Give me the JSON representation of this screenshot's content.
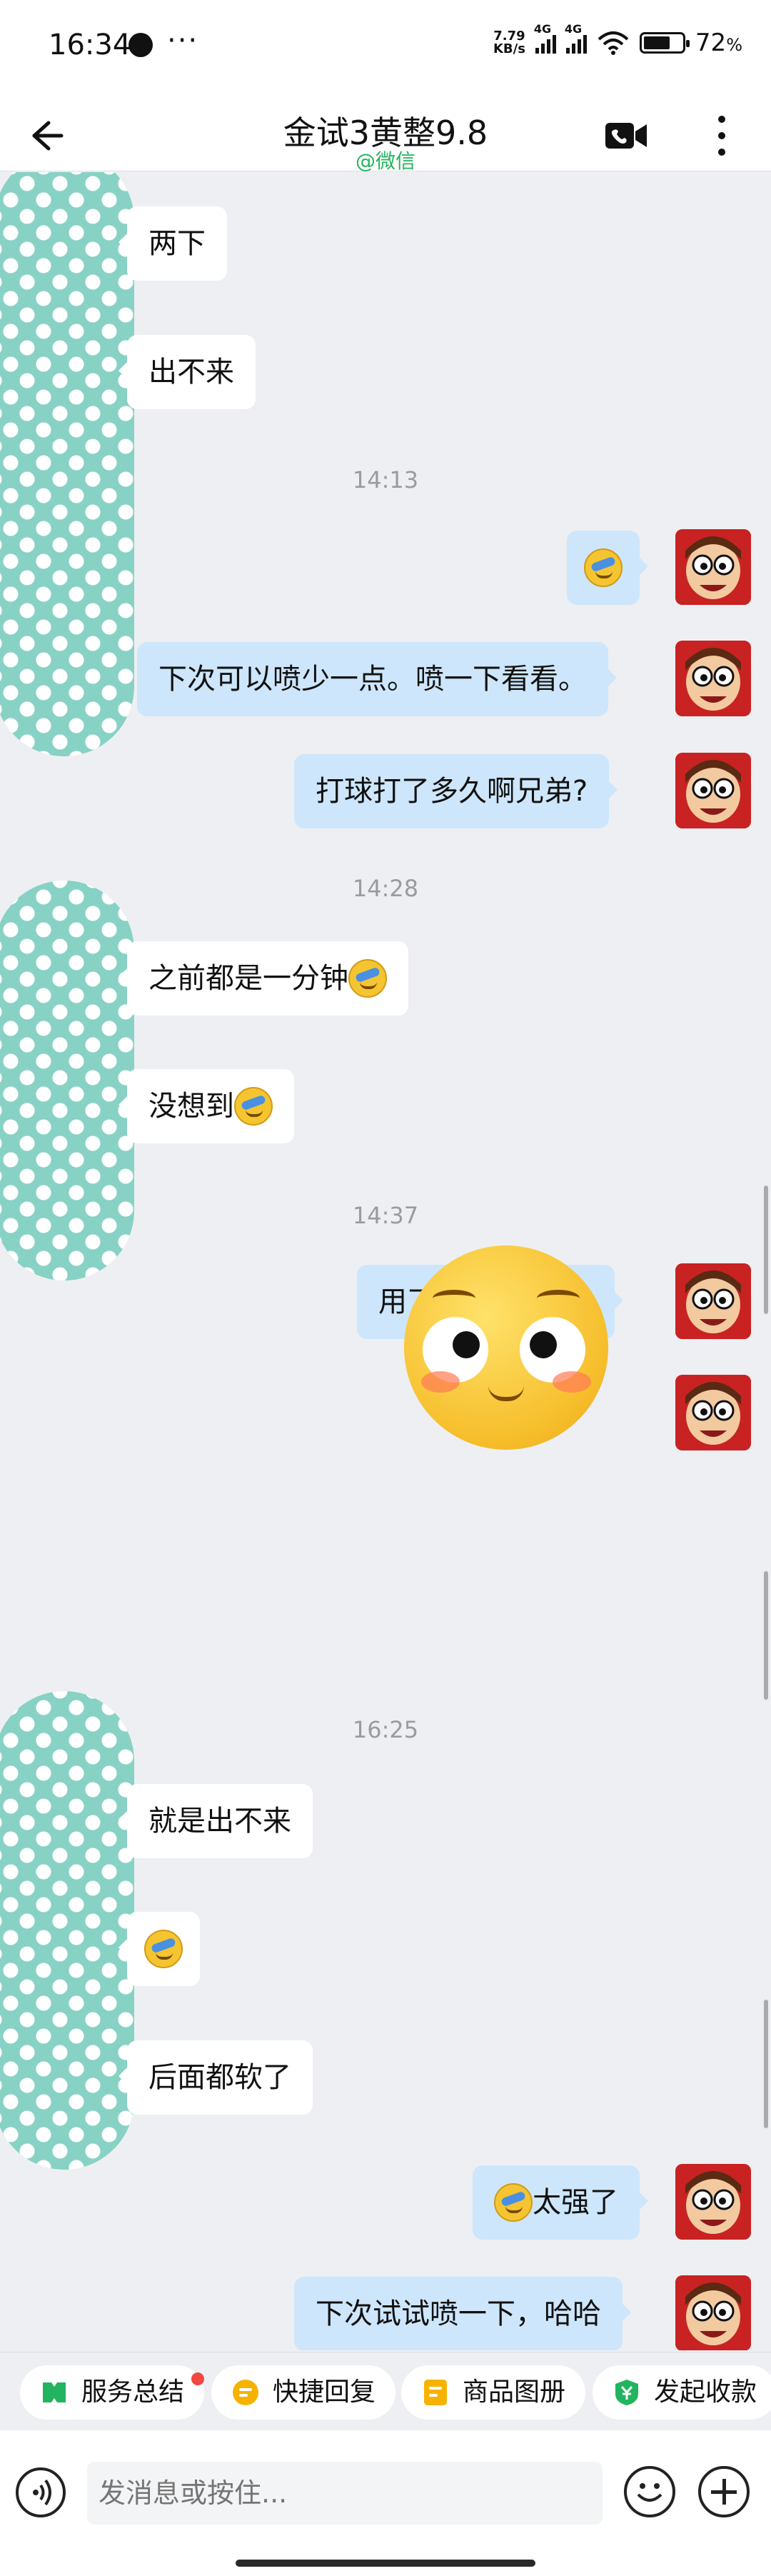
{
  "status_bar": {
    "time": "16:34",
    "app_icon": "qq-penguin-icon",
    "more": "···",
    "net_speed_value": "7.79",
    "net_speed_unit": "KB/s",
    "sim1_type": "4G",
    "sim2_type": "4G",
    "battery": "72",
    "battery_unit": "%"
  },
  "header": {
    "title": "金试3黄整9.8",
    "subtitle": "@微信"
  },
  "messages": [
    {
      "id": "m1",
      "side": "left",
      "text": "两下"
    },
    {
      "id": "m2",
      "side": "left",
      "text": "出不来"
    },
    {
      "id": "t1",
      "type": "time",
      "text": "14:13"
    },
    {
      "id": "m3",
      "side": "right",
      "emoji": "laughing-tears-emoji"
    },
    {
      "id": "m4",
      "side": "right",
      "text": "下次可以喷少一点。喷一下看看。"
    },
    {
      "id": "m5",
      "side": "right",
      "text": "打球打了多久啊兄弟?"
    },
    {
      "id": "t2",
      "type": "time",
      "text": "14:28"
    },
    {
      "id": "m6",
      "side": "left",
      "text": "之前都是一分钟",
      "emoji": "laughing-tears-emoji"
    },
    {
      "id": "m7",
      "side": "left",
      "text": "没想到",
      "emoji": "laughing-tears-emoji"
    },
    {
      "id": "t3",
      "type": "time",
      "text": "14:37"
    },
    {
      "id": "m8",
      "side": "right",
      "text": "用了金喷以后呢?"
    },
    {
      "id": "m9",
      "side": "right",
      "sticker": "shy-blushing-face-sticker"
    },
    {
      "id": "t4",
      "type": "time",
      "text": "16:25"
    },
    {
      "id": "m10",
      "side": "left",
      "text": "就是出不来"
    },
    {
      "id": "m11",
      "side": "left",
      "emoji": "laughing-tears-emoji"
    },
    {
      "id": "m12",
      "side": "left",
      "text": "后面都软了"
    },
    {
      "id": "m13",
      "side": "right",
      "text": "太强了",
      "emoji": "laughing-tears-emoji"
    },
    {
      "id": "m14",
      "side": "right",
      "text": "下次试试喷一下，哈哈"
    }
  ],
  "quick_actions": [
    {
      "label": "服务总结",
      "icon": "summary-icon",
      "color": "#22b45e",
      "badge": true
    },
    {
      "label": "快捷回复",
      "icon": "quick-reply-icon",
      "color": "#f5b300",
      "badge": false
    },
    {
      "label": "商品图册",
      "icon": "product-album-icon",
      "color": "#f5b300",
      "badge": false
    },
    {
      "label": "发起收款",
      "icon": "payment-icon",
      "color": "#22b45e",
      "badge": false
    }
  ],
  "input": {
    "placeholder": "发消息或按住..."
  },
  "colors": {
    "accent_green": "#22b45e",
    "bubble_right": "#cde6fb",
    "bubble_left": "#ffffff",
    "chat_background": "#eeeff3",
    "contact_avatar": "#87d2c4"
  }
}
